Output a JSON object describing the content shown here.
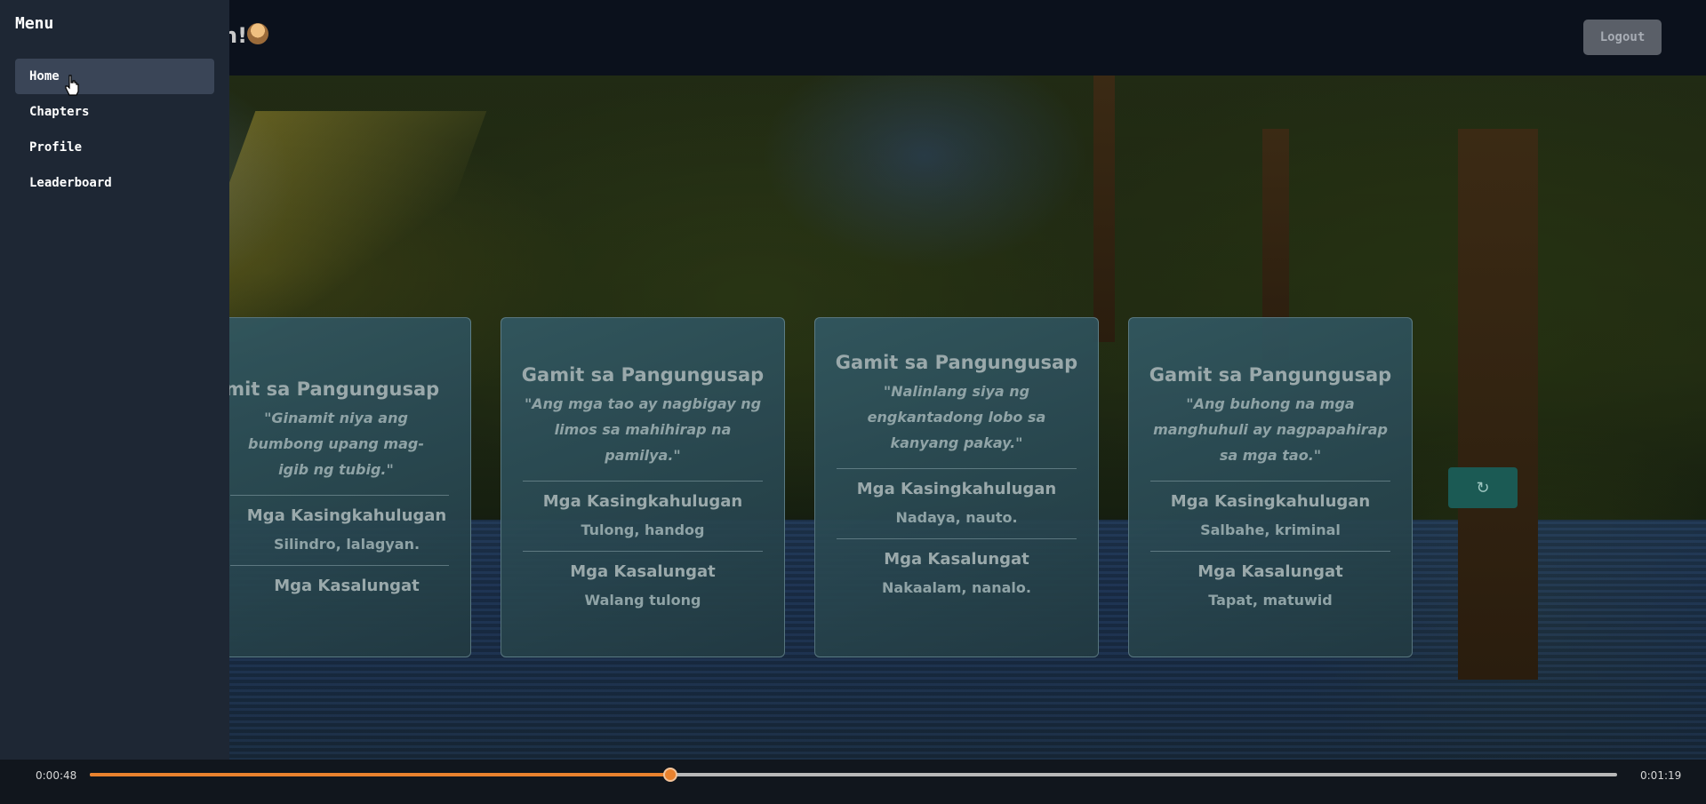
{
  "header": {
    "greeting_tail": "n!",
    "logout_label": "Logout"
  },
  "sidebar": {
    "title": "Menu",
    "items": [
      {
        "label": "Home",
        "active": true
      },
      {
        "label": "Chapters",
        "active": false
      },
      {
        "label": "Profile",
        "active": false
      },
      {
        "label": "Leaderboard",
        "active": false
      }
    ]
  },
  "cards": [
    {
      "title": "Gamit sa Pangungusap",
      "sentence": "\"Ginamit niya ang bumbong upang mag-igib ng tubig.\"",
      "synonyms_heading": "Mga Kasingkahulugan",
      "synonyms": "Silindro, lalagyan.",
      "antonyms_heading": "Mga Kasalungat",
      "antonyms": ""
    },
    {
      "title": "Gamit sa Pangungusap",
      "sentence": "\"Ang mga tao ay nagbigay ng limos sa mahihirap na pamilya.\"",
      "synonyms_heading": "Mga Kasingkahulugan",
      "synonyms": "Tulong, handog",
      "antonyms_heading": "Mga Kasalungat",
      "antonyms": "Walang tulong"
    },
    {
      "title": "Gamit sa Pangungusap",
      "sentence": "\"Nalinlang siya ng engkantadong lobo sa kanyang pakay.\"",
      "synonyms_heading": "Mga Kasingkahulugan",
      "synonyms": "Nadaya, nauto.",
      "antonyms_heading": "Mga Kasalungat",
      "antonyms": "Nakaalam, nanalo."
    },
    {
      "title": "Gamit sa Pangungusap",
      "sentence": "\"Ang buhong na mga manghuhuli ay nagpapahirap sa mga tao.\"",
      "synonyms_heading": "Mga Kasingkahulugan",
      "synonyms": "Salbahe, kriminal",
      "antonyms_heading": "Mga Kasalungat",
      "antonyms": "Tapat, matuwid"
    }
  ],
  "refresh_icon": "↻",
  "media": {
    "current_time": "0:00:48",
    "total_time": "0:01:19",
    "progress": 0.38,
    "accent": "#e9822e"
  }
}
